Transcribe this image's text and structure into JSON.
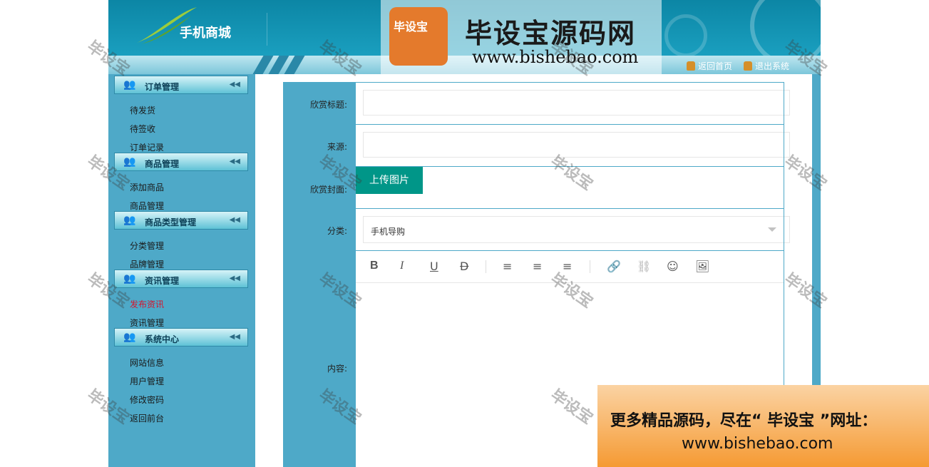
{
  "app": {
    "title": "手机商城"
  },
  "top_links": {
    "home": "返回首页",
    "logout": "退出系统"
  },
  "sidebar": {
    "sections": [
      {
        "title": "订单管理",
        "items": [
          "待发货",
          "待签收",
          "订单记录"
        ]
      },
      {
        "title": "商品管理",
        "items": [
          "添加商品",
          "商品管理"
        ]
      },
      {
        "title": "商品类型管理",
        "items": [
          "分类管理",
          "品牌管理"
        ]
      },
      {
        "title": "资讯管理",
        "items": [
          "发布资讯",
          "资讯管理"
        ],
        "active_item": "发布资讯"
      },
      {
        "title": "系统中心",
        "items": [
          "网站信息",
          "用户管理",
          "修改密码",
          "返回前台"
        ]
      }
    ]
  },
  "form": {
    "title_label": "欣赏标题:",
    "title_value": "",
    "source_label": "来源:",
    "source_value": "",
    "cover_label": "欣赏封面:",
    "upload_button": "上传图片",
    "category_label": "分类:",
    "category_value": "手机导购",
    "content_label": "内容:"
  },
  "editor_toolbar": [
    "bold-icon",
    "italic-icon",
    "underline-icon",
    "strikethrough-icon",
    "align-left-icon",
    "align-center-icon",
    "align-right-icon",
    "link-icon",
    "unlink-icon",
    "emoji-icon",
    "image-icon"
  ],
  "watermark": {
    "text": "毕设宝",
    "logo_badge": "毕设宝",
    "logo_title": "毕设宝源码网",
    "logo_url": "www.bishebao.com",
    "promo_line1": "更多精品源码，尽在“ 毕设宝 ”网址：",
    "promo_line2": "www.bishebao.com"
  },
  "colors": {
    "header": "#0c86a5",
    "sidebar": "#4ea9c8",
    "upload_button": "#009688",
    "active_item": "#d5152e"
  }
}
